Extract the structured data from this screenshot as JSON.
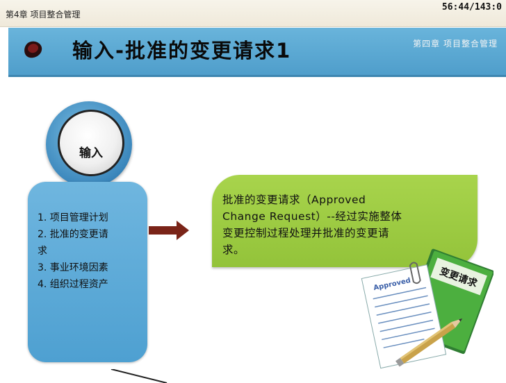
{
  "header": {
    "chapter_label": "第4章 项目整合管理",
    "timer": "56:44/143:0"
  },
  "banner": {
    "title": "输入-批准的变更请求1",
    "subtitle": "第四章 项目整合管理",
    "bullet_icon": "red-blob-bullet"
  },
  "diagram": {
    "circle_label": "输入",
    "items": [
      "1. 项目管理计划",
      "2. 批准的变更请",
      "求",
      "3. 事业环境因素",
      "4. 组织过程资产"
    ],
    "arrow_icon": "right-arrow",
    "arrow_color": "#7a2418"
  },
  "callout": {
    "lines": [
      "批准的变更请求（Approved",
      "Change Request）--经过实施整体",
      "变更控制过程处理并批准的变更请",
      "求。"
    ],
    "color": "#9ccb42"
  },
  "illustration": {
    "book_label": "变更请求",
    "paper_stamp": "Approved"
  },
  "colors": {
    "banner": "#5aa8d6",
    "box": "#5ba9d8",
    "callout": "#9ccb42"
  }
}
